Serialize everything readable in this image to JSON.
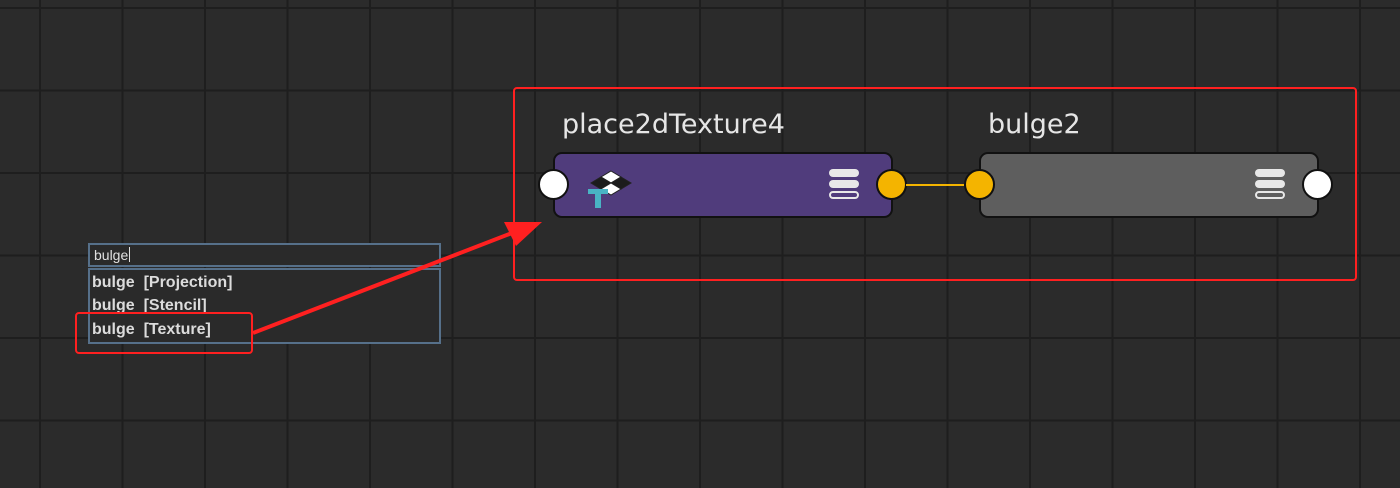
{
  "graph": {
    "nodes": [
      {
        "id": "place",
        "title": "place2dTexture4",
        "color": "#503c7c",
        "icon": "place2d-texture-icon"
      },
      {
        "id": "bulge",
        "title": "bulge2",
        "color": "#5e5e5e",
        "icon": ""
      }
    ],
    "connection_color": "#f4b400"
  },
  "search": {
    "query": "bulge",
    "results": [
      {
        "name": "bulge",
        "category": "[Projection]"
      },
      {
        "name": "bulge",
        "category": "[Stencil]"
      },
      {
        "name": "bulge",
        "category": "[Texture]"
      }
    ]
  },
  "annotation": {
    "color": "#ff2020",
    "highlighted_result": 2
  }
}
